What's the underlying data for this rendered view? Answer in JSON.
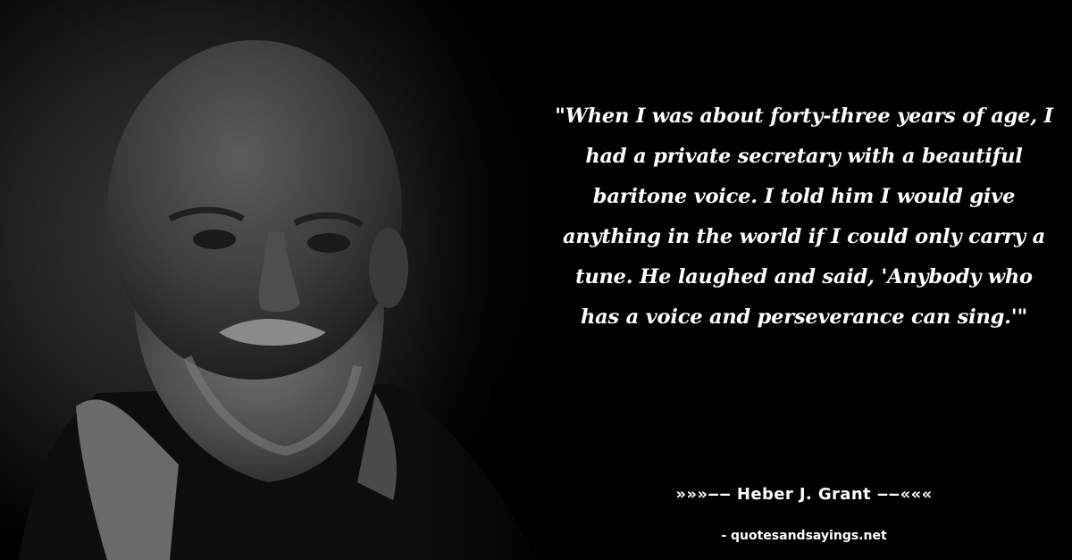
{
  "quote": {
    "text": "\"When I was about forty-three years of age, I had a private secretary with a beautiful baritone voice. I told him I would give anything in the world if I could only carry a tune. He laughed and said, 'Anybody who has a voice and perseverance can sing.'\"",
    "author_line": "»»»‒‒ Heber J. Grant ‒‒«««",
    "source": "- quotesandsayings.net"
  },
  "colors": {
    "background": "#000000",
    "text": "#ffffff"
  }
}
